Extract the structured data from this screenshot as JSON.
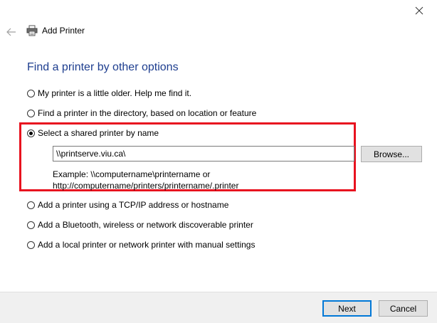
{
  "window": {
    "title": "Add Printer"
  },
  "page": {
    "heading": "Find a printer by other options"
  },
  "options": [
    {
      "label": "My printer is a little older. Help me find it.",
      "selected": false
    },
    {
      "label": "Find a printer in the directory, based on location or feature",
      "selected": false
    },
    {
      "label": "Select a shared printer by name",
      "selected": true
    },
    {
      "label": "Add a printer using a TCP/IP address or hostname",
      "selected": false
    },
    {
      "label": "Add a Bluetooth, wireless or network discoverable printer",
      "selected": false
    },
    {
      "label": "Add a local printer or network printer with manual settings",
      "selected": false
    }
  ],
  "shared_printer": {
    "value": "\\\\printserve.viu.ca\\",
    "browse_label": "Browse...",
    "example_line1": "Example: \\\\computername\\printername or",
    "example_line2": "http://computername/printers/printername/.printer"
  },
  "footer": {
    "next_label": "Next",
    "cancel_label": "Cancel"
  },
  "colors": {
    "heading": "#1e3e8f",
    "highlight": "#e8121f",
    "primary_border": "#0078d7"
  }
}
